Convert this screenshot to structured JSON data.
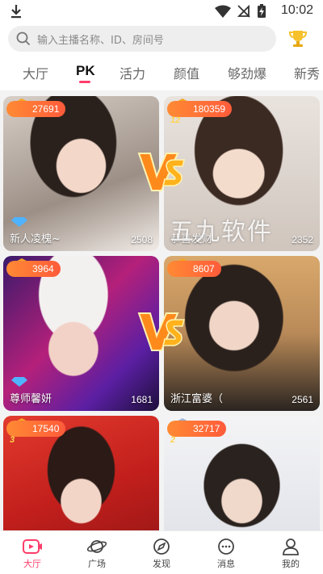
{
  "status_bar": {
    "time": "10:02"
  },
  "search": {
    "placeholder": "输入主播名称、ID、房间号"
  },
  "tabs": [
    {
      "label": "大厅"
    },
    {
      "label": "PK"
    },
    {
      "label": "活力"
    },
    {
      "label": "颜值"
    },
    {
      "label": "够劲爆"
    },
    {
      "label": "新秀"
    }
  ],
  "active_tab": "PK",
  "cards": [
    {
      "badge_count": "27691",
      "level": "",
      "name": "新人凌槐~",
      "viewers": "2508"
    },
    {
      "badge_count": "180359",
      "level": "12",
      "name": "恭喜发财",
      "viewers": "2352"
    },
    {
      "badge_count": "3964",
      "level": "",
      "name": "尊师馨妍",
      "viewers": "1681"
    },
    {
      "badge_count": "8607",
      "level": "",
      "name": "浙江富婆（",
      "viewers": "2561"
    },
    {
      "badge_count": "17540",
      "level": "3",
      "name": "",
      "viewers": ""
    },
    {
      "badge_count": "32717",
      "level": "2",
      "name": "",
      "viewers": ""
    }
  ],
  "watermark": "五九软件",
  "nav": [
    {
      "label": "大厅"
    },
    {
      "label": "广场"
    },
    {
      "label": "发现"
    },
    {
      "label": "消息"
    },
    {
      "label": "我的"
    }
  ],
  "colors": {
    "accent": "#ff3d6b",
    "badge": "#ff6a36"
  }
}
